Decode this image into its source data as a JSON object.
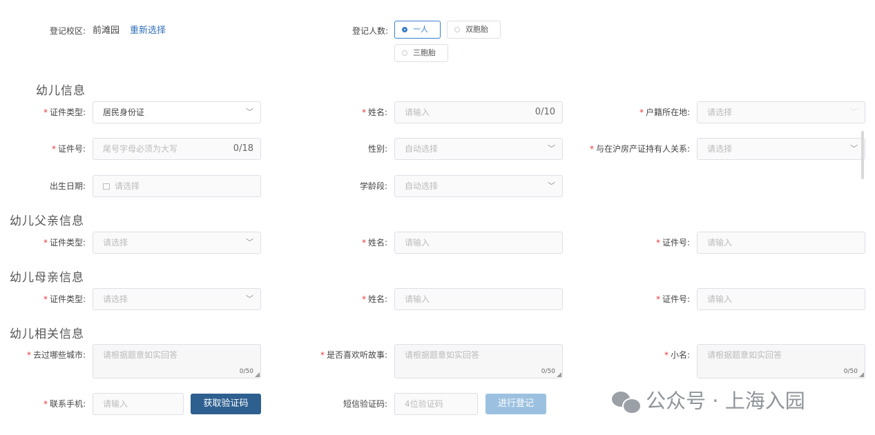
{
  "campus": {
    "label": "登记校区:",
    "value": "前滩园",
    "reselect": "重新选择"
  },
  "count": {
    "label": "登记人数:",
    "options": [
      "一人",
      "双胞胎",
      "三胞胎"
    ],
    "selected": "一人"
  },
  "child": {
    "title": "幼儿信息",
    "id_type_label": "证件类型:",
    "id_type_value": "居民身份证",
    "name_label": "姓名:",
    "name_placeholder": "请输入",
    "name_count": "0/10",
    "hukou_label": "户籍所在地:",
    "hukou_placeholder": "请选择",
    "id_no_label": "证件号:",
    "id_no_placeholder": "尾号字母必须为大写",
    "id_no_count": "0/18",
    "gender_label": "性别:",
    "gender_placeholder": "自动选择",
    "relation_label": "与在沪房产证持有人关系:",
    "relation_placeholder": "请选择",
    "birth_label": "出生日期:",
    "birth_placeholder": "请选择",
    "grade_label": "学龄段:",
    "grade_placeholder": "自动选择"
  },
  "father": {
    "title": "幼儿父亲信息",
    "id_type_label": "证件类型:",
    "id_type_placeholder": "请选择",
    "name_label": "姓名:",
    "name_placeholder": "请输入",
    "id_no_label": "证件号:",
    "id_no_placeholder": "请输入"
  },
  "mother": {
    "title": "幼儿母亲信息",
    "id_type_label": "证件类型:",
    "id_type_placeholder": "请选择",
    "name_label": "姓名:",
    "name_placeholder": "请输入",
    "id_no_label": "证件号:",
    "id_no_placeholder": "请输入"
  },
  "related": {
    "title": "幼儿相关信息",
    "cities_label": "去过哪些城市:",
    "cities_placeholder": "请根据题意如实回答",
    "stories_label": "是否喜欢听故事:",
    "stories_placeholder": "请根据题意如实回答",
    "nickname_label": "小名:",
    "nickname_placeholder": "请根据题意如实回答",
    "count": "0/50"
  },
  "contact": {
    "phone_label": "联系手机:",
    "phone_placeholder": "请输入",
    "get_code": "获取验证码",
    "sms_label": "短信验证码:",
    "sms_placeholder": "4位验证码",
    "submit": "进行登记"
  },
  "watermark": {
    "text": "公众号 · 上海入园"
  },
  "colors": {
    "accent": "#3a7dc9",
    "primary_button": "#2d5f8f",
    "disabled_button": "#9cc1e0",
    "required": "#e4393c"
  }
}
